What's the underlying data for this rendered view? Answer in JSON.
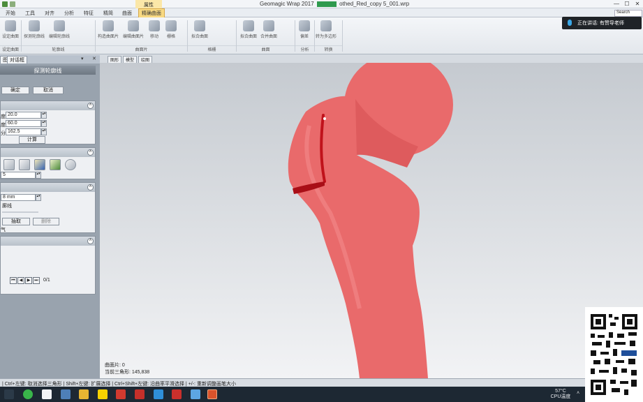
{
  "window": {
    "title_prefix": "Geomagic Wrap 2017",
    "badge_text": "",
    "title_suffix": "othed_Red_copy 5_001.wrp",
    "minimize": "—",
    "restore": "☐",
    "close": "✕"
  },
  "ribbon": {
    "context_tab": "属性",
    "tabs": [
      "开始",
      "工具",
      "对齐",
      "分析",
      "特征",
      "精简",
      "曲面",
      "精确曲面"
    ],
    "active_tab_index": 7,
    "search_placeholder": "Search",
    "buttons": [
      {
        "label": "设定曲面",
        "icon": "wrench-icon"
      },
      {
        "label": "探测轮廓线",
        "icon": "contour-probe-icon"
      },
      {
        "label": "编辑轮廓线",
        "icon": "contour-edit-icon"
      },
      {
        "label": "构造曲面片",
        "icon": "patch-build-icon"
      },
      {
        "label": "编辑曲面片",
        "icon": "patch-edit-icon"
      },
      {
        "label": "移动",
        "icon": "move-icon"
      },
      {
        "label": "栅格",
        "icon": "grid-icon"
      },
      {
        "label": "拟合曲面",
        "icon": "fit-surface-icon"
      },
      {
        "label": "拟合曲面",
        "icon": "fit-surface-2-icon"
      },
      {
        "label": "合并曲面",
        "icon": "merge-surface-icon"
      },
      {
        "label": "偏差",
        "icon": "deviation-icon"
      },
      {
        "label": "转为多边形",
        "icon": "polygon-convert-icon"
      }
    ],
    "groups": [
      "设定曲面",
      "轮廓线",
      "曲面片",
      "格栅",
      "曲面",
      "分析",
      "转换"
    ]
  },
  "notification": {
    "text": "正在讲话: 有赞导老师"
  },
  "left_panel": {
    "tabs": [
      "图",
      "对话框"
    ],
    "controls": [
      "▾",
      "✕"
    ],
    "header": "探测轮廓线",
    "ok": "确定",
    "cancel": "取消",
    "params": [
      {
        "label": "度",
        "value": "20.0"
      },
      {
        "label": "度",
        "value": "60.0"
      },
      {
        "label": "分",
        "value": "162.5"
      }
    ],
    "compute": "计算",
    "spin_value": "5",
    "distance_value": "8 mm",
    "section3_text": "廓线",
    "extract": "抽取",
    "delete": "删除",
    "section3_tail": "气",
    "pager": {
      "first": "⏮",
      "prev": "◀",
      "next": "▶",
      "last": "⏭",
      "count": "0/1"
    },
    "collapse_glyph": "˄"
  },
  "viewport": {
    "tabs": [
      "图形",
      "模型",
      "绘图"
    ],
    "stats": [
      "曲面片: 0",
      "当前三角形: 145,838"
    ],
    "model_color": "#e96a6b",
    "contour_color": "#c0121b"
  },
  "status_bar": {
    "text": "| Ctrl+左键: 取消选择三角形 | Shift+左键: 扩展选择 | Ctrl+Shift+左键: 沿曲率平滑选择 | +/-: 重新调整画笔大小"
  },
  "taskbar": {
    "temp": "57°C",
    "cpu": "CPU温度",
    "tray_up": "˄"
  }
}
